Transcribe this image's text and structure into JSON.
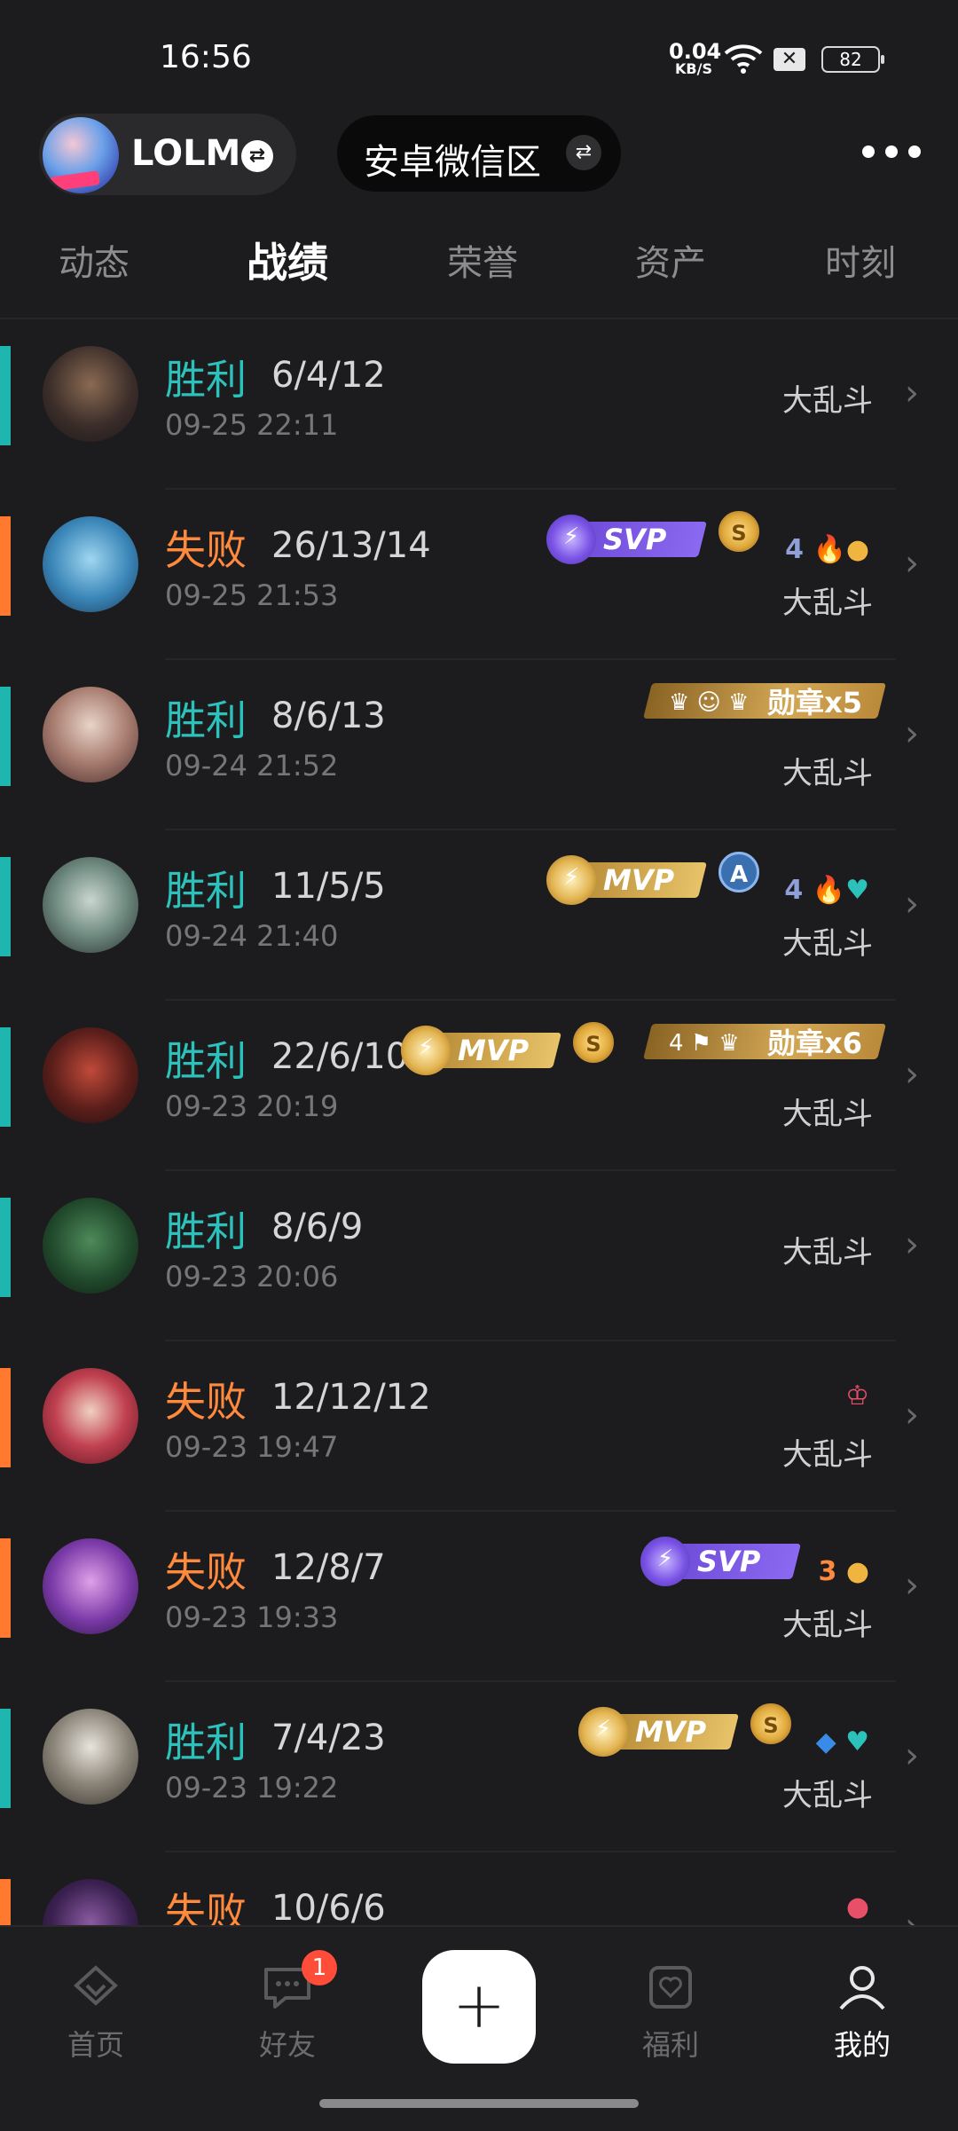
{
  "status_bar": {
    "time": "16:56",
    "net_speed": "0.04",
    "net_unit": "KB/S",
    "battery": "82"
  },
  "header": {
    "account_name": "LOLM",
    "region": "安卓微信区"
  },
  "tabs": [
    "动态",
    "战绩",
    "荣誉",
    "资产",
    "时刻"
  ],
  "active_tab": "战绩",
  "matches": [
    {
      "result": "胜利",
      "outcome": "win",
      "kda": "6/4/12",
      "date": "09-25 22:11",
      "mode": "大乱斗"
    },
    {
      "result": "失败",
      "outcome": "lose",
      "kda": "26/13/14",
      "date": "09-25 21:53",
      "mode": "大乱斗",
      "svp": "SVP",
      "coin": "S",
      "mini": "4"
    },
    {
      "result": "胜利",
      "outcome": "win",
      "kda": "8/6/13",
      "date": "09-24 21:52",
      "mode": "大乱斗",
      "medal": "勋章x5"
    },
    {
      "result": "胜利",
      "outcome": "win",
      "kda": "11/5/5",
      "date": "09-24 21:40",
      "mode": "大乱斗",
      "mvp": "MVP",
      "a_icon": "A",
      "mini": "4"
    },
    {
      "result": "胜利",
      "outcome": "win",
      "kda": "22/6/10",
      "date": "09-23 20:19",
      "mode": "大乱斗",
      "mvp": "MVP",
      "coin": "S",
      "medal": "勋章x6",
      "medal_prefix": "4"
    },
    {
      "result": "胜利",
      "outcome": "win",
      "kda": "8/6/9",
      "date": "09-23 20:06",
      "mode": "大乱斗"
    },
    {
      "result": "失败",
      "outcome": "lose",
      "kda": "12/12/12",
      "date": "09-23 19:47",
      "mode": "大乱斗"
    },
    {
      "result": "失败",
      "outcome": "lose",
      "kda": "12/8/7",
      "date": "09-23 19:33",
      "mode": "大乱斗",
      "svp": "SVP",
      "mini": "3"
    },
    {
      "result": "胜利",
      "outcome": "win",
      "kda": "7/4/23",
      "date": "09-23 19:22",
      "mode": "大乱斗",
      "mvp": "MVP",
      "coin": "S"
    },
    {
      "result": "失败",
      "outcome": "lose",
      "kda": "10/6/6",
      "date": "",
      "mode": ""
    }
  ],
  "bottom_nav": {
    "home": "首页",
    "friends": "好友",
    "friends_badge": "1",
    "add": "+",
    "welfare": "福利",
    "me": "我的"
  },
  "colors": {
    "win": "#2cc2bb",
    "lose": "#ff8a3d",
    "background": "#1c1c1e"
  }
}
